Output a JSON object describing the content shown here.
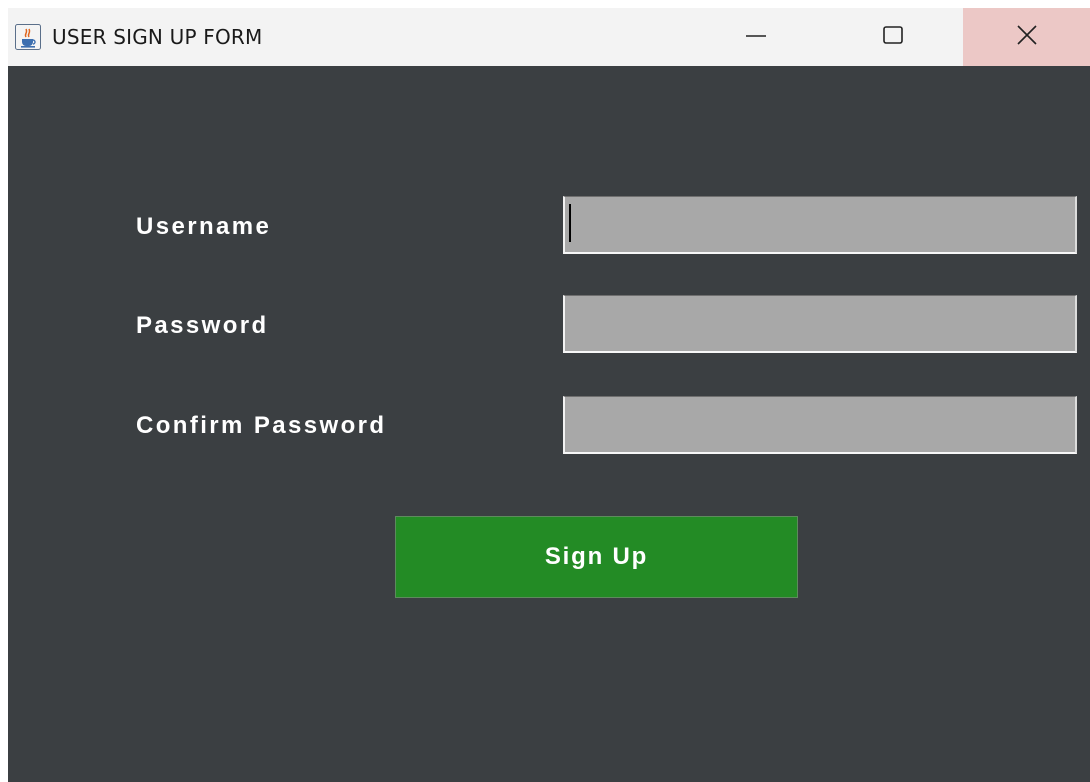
{
  "window": {
    "title": "USER SIGN UP FORM",
    "icon": "java-cup-icon",
    "controls": [
      "minimize-icon",
      "maximize-icon",
      "close-icon"
    ]
  },
  "form": {
    "username_label": "Username",
    "username_value": "",
    "password_label": "Password",
    "password_value": "",
    "confirm_password_label": "Confirm Password",
    "confirm_password_value": "",
    "submit_label": "Sign Up"
  },
  "colors": {
    "background": "#3b3f42",
    "titlebar": "#f3f3f3",
    "close_hover": "#ecc8c6",
    "field": "#a8a8a8",
    "button": "#238b25",
    "label_text": "#ffffff"
  }
}
